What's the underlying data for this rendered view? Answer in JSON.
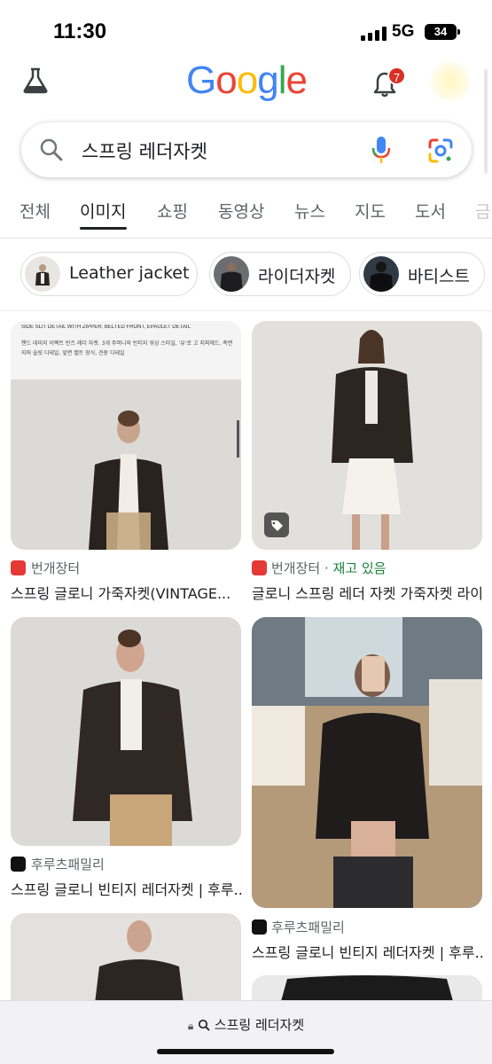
{
  "status_bar": {
    "time": "11:30",
    "network": "5G",
    "battery": "34"
  },
  "header": {
    "logo": [
      "G",
      "o",
      "o",
      "g",
      "l",
      "e"
    ],
    "notification_count": "7"
  },
  "search": {
    "query": "스프링 레더자켓"
  },
  "tabs": [
    {
      "label": "전체"
    },
    {
      "label": "이미지"
    },
    {
      "label": "쇼핑"
    },
    {
      "label": "동영상"
    },
    {
      "label": "뉴스"
    },
    {
      "label": "지도"
    },
    {
      "label": "도서"
    },
    {
      "label": "금"
    }
  ],
  "chips": [
    {
      "label": "Leather jacket"
    },
    {
      "label": "라이더자켓"
    },
    {
      "label": "바티스트"
    }
  ],
  "results": [
    {
      "caption_top": "SIDE SLIT DETAIL WITH ZIPPER, BELTED FRONT, EPAULET DETAIL",
      "caption_body": "핸드 데미지 이펙트 빈즈 레더 자켓. 3개 주머니와 빈티지 워싱 스타일, '유'로 고 지퍼헤드, 측면 지퍼 슬릿 디테일, 앞면 벨트 장식, 견장 디테일",
      "source": "번개장터",
      "title": "스프링 글로니 가죽자켓(VINTAGE..."
    },
    {
      "source": "번개장터",
      "stock": "재고 있음",
      "title": "글로니 스프링 레더 자켓 가죽자켓 라이..."
    },
    {
      "source": "후루츠패밀리",
      "title": "스프링 글로니 빈티지 레더자켓 | 후루..."
    },
    {
      "source": "후루츠패밀리",
      "title": "스프링 글로니 빈티지 레더자켓 | 후루..."
    }
  ],
  "bottom_bar": {
    "url": "스프링 레더자켓"
  },
  "colors": {
    "google_blue": "#4285F4",
    "google_red": "#EA4335",
    "google_yellow": "#FBBC05",
    "google_green": "#34A853",
    "stock_green": "#188038"
  }
}
